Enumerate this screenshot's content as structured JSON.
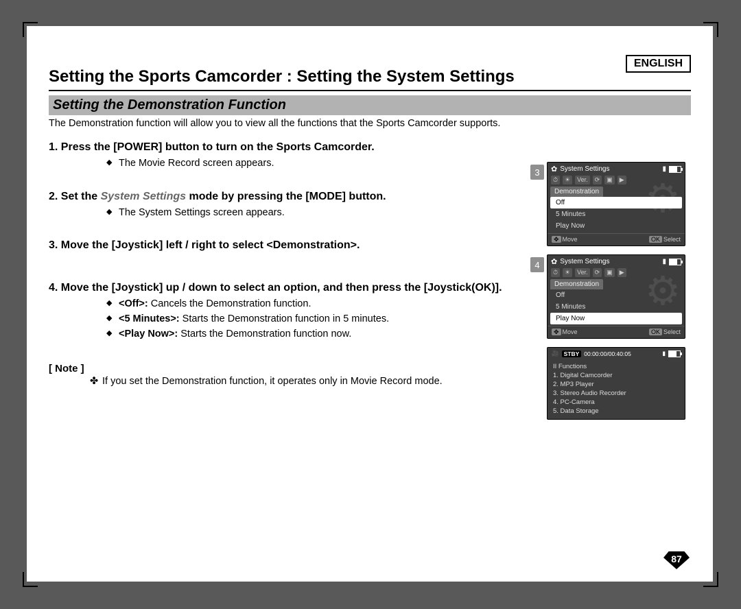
{
  "header": {
    "language": "ENGLISH",
    "title": "Setting the Sports Camcorder : Setting the System Settings",
    "subtitle": "Setting the Demonstration Function",
    "intro": "The Demonstration function will allow you to view all the functions that the Sports Camcorder supports."
  },
  "steps": [
    {
      "title": "1. Press the [POWER] button to turn on the Sports Camcorder.",
      "bullets": [
        "The Movie Record screen appears."
      ]
    },
    {
      "title_a": "2. Set the ",
      "title_em": "System Settings",
      "title_b": " mode by pressing the [MODE] button.",
      "bullets": [
        "The System Settings screen appears."
      ]
    },
    {
      "title": "3. Move the [Joystick] left / right to select <Demonstration>."
    },
    {
      "title": "4. Move the [Joystick] up / down to select an option, and then press the [Joystick(OK)].",
      "bullets": [
        {
          "k": "<Off>:",
          "v": "Cancels the Demonstration function."
        },
        {
          "k": "<5 Minutes>:",
          "v": "Starts the Demonstration function in 5 minutes."
        },
        {
          "k": "<Play Now>:",
          "v": "Starts the Demonstration function now."
        }
      ]
    }
  ],
  "note": {
    "heading": "[ Note ]",
    "items": [
      "If you set the Demonstration function, it operates only in Movie Record mode."
    ]
  },
  "shots": [
    {
      "num": "3",
      "title": "System Settings",
      "tab": "Demonstration",
      "options": [
        "Off",
        "5 Minutes",
        "Play Now"
      ],
      "footer": [
        "Move",
        "Select"
      ]
    },
    {
      "num": "4",
      "title": "System Settings",
      "tab": "Demonstration",
      "options": [
        "Off",
        "5 Minutes",
        "Play Now"
      ],
      "footer": [
        "Move",
        "Select"
      ]
    },
    {
      "stby": "STBY",
      "timecode": "00:00:00/00:40:05",
      "heading": "II Functions",
      "items": [
        "1. Digital Camcorder",
        "2. MP3 Player",
        "3. Stereo Audio Recorder",
        "4. PC-Camera",
        "5. Data Storage"
      ]
    }
  ],
  "page_number": "87"
}
